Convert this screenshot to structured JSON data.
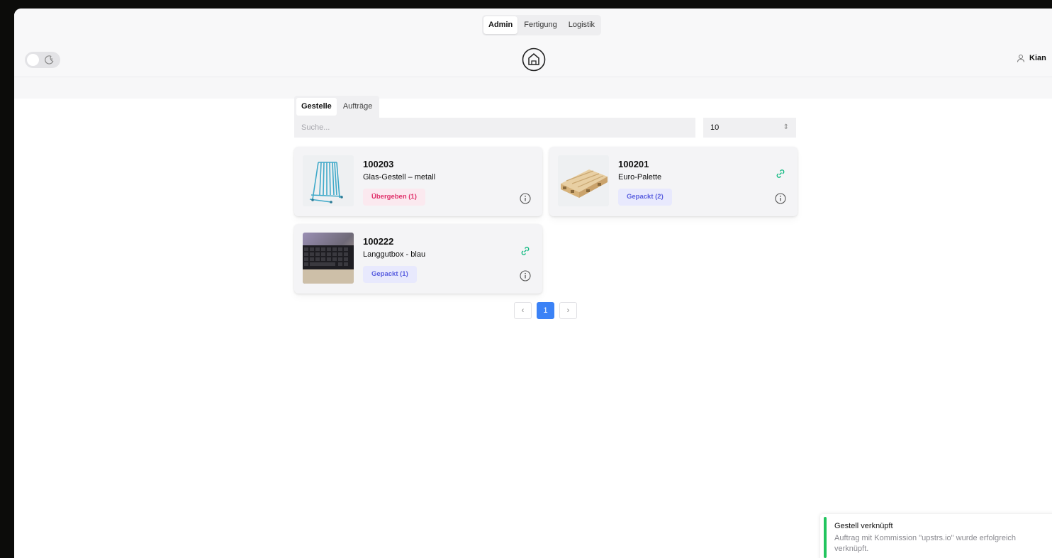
{
  "nav": {
    "modes": [
      {
        "label": "Admin",
        "active": true
      },
      {
        "label": "Fertigung",
        "active": false
      },
      {
        "label": "Logistik",
        "active": false
      }
    ],
    "user_name": "Kian",
    "theme_toggle": {
      "state": "light",
      "icon": "moon-icon"
    }
  },
  "content_tabs": [
    {
      "label": "Gestelle",
      "active": true
    },
    {
      "label": "Aufträge",
      "active": false
    }
  ],
  "search": {
    "placeholder": "Suche...",
    "value": ""
  },
  "page_size": {
    "value": "10"
  },
  "racks": [
    {
      "code": "100203",
      "name": "Glas-Gestell – metall",
      "status": "Übergeben (1)",
      "status_color": "#e0306a",
      "linked": false,
      "thumb": "glass-rack"
    },
    {
      "code": "100201",
      "name": "Euro-Palette",
      "status": "Gepackt (2)",
      "status_color": "#5a5fe0",
      "linked": true,
      "thumb": "euro-pallet"
    },
    {
      "code": "100222",
      "name": "Langgutbox - blau",
      "status": "Gepackt (1)",
      "status_color": "#5a5fe0",
      "linked": true,
      "thumb": "laptop-keyboard"
    }
  ],
  "pagination": {
    "current": "1",
    "prev": "‹",
    "next": "›"
  },
  "toast": {
    "title": "Gestell verknüpft",
    "message": "Auftrag mit Kommission \"upstrs.io\" wurde erfolgreich verknüpft.",
    "accent": "#22c55e"
  },
  "colors": {
    "accent": "#3b82f6",
    "link": "#10b981"
  }
}
